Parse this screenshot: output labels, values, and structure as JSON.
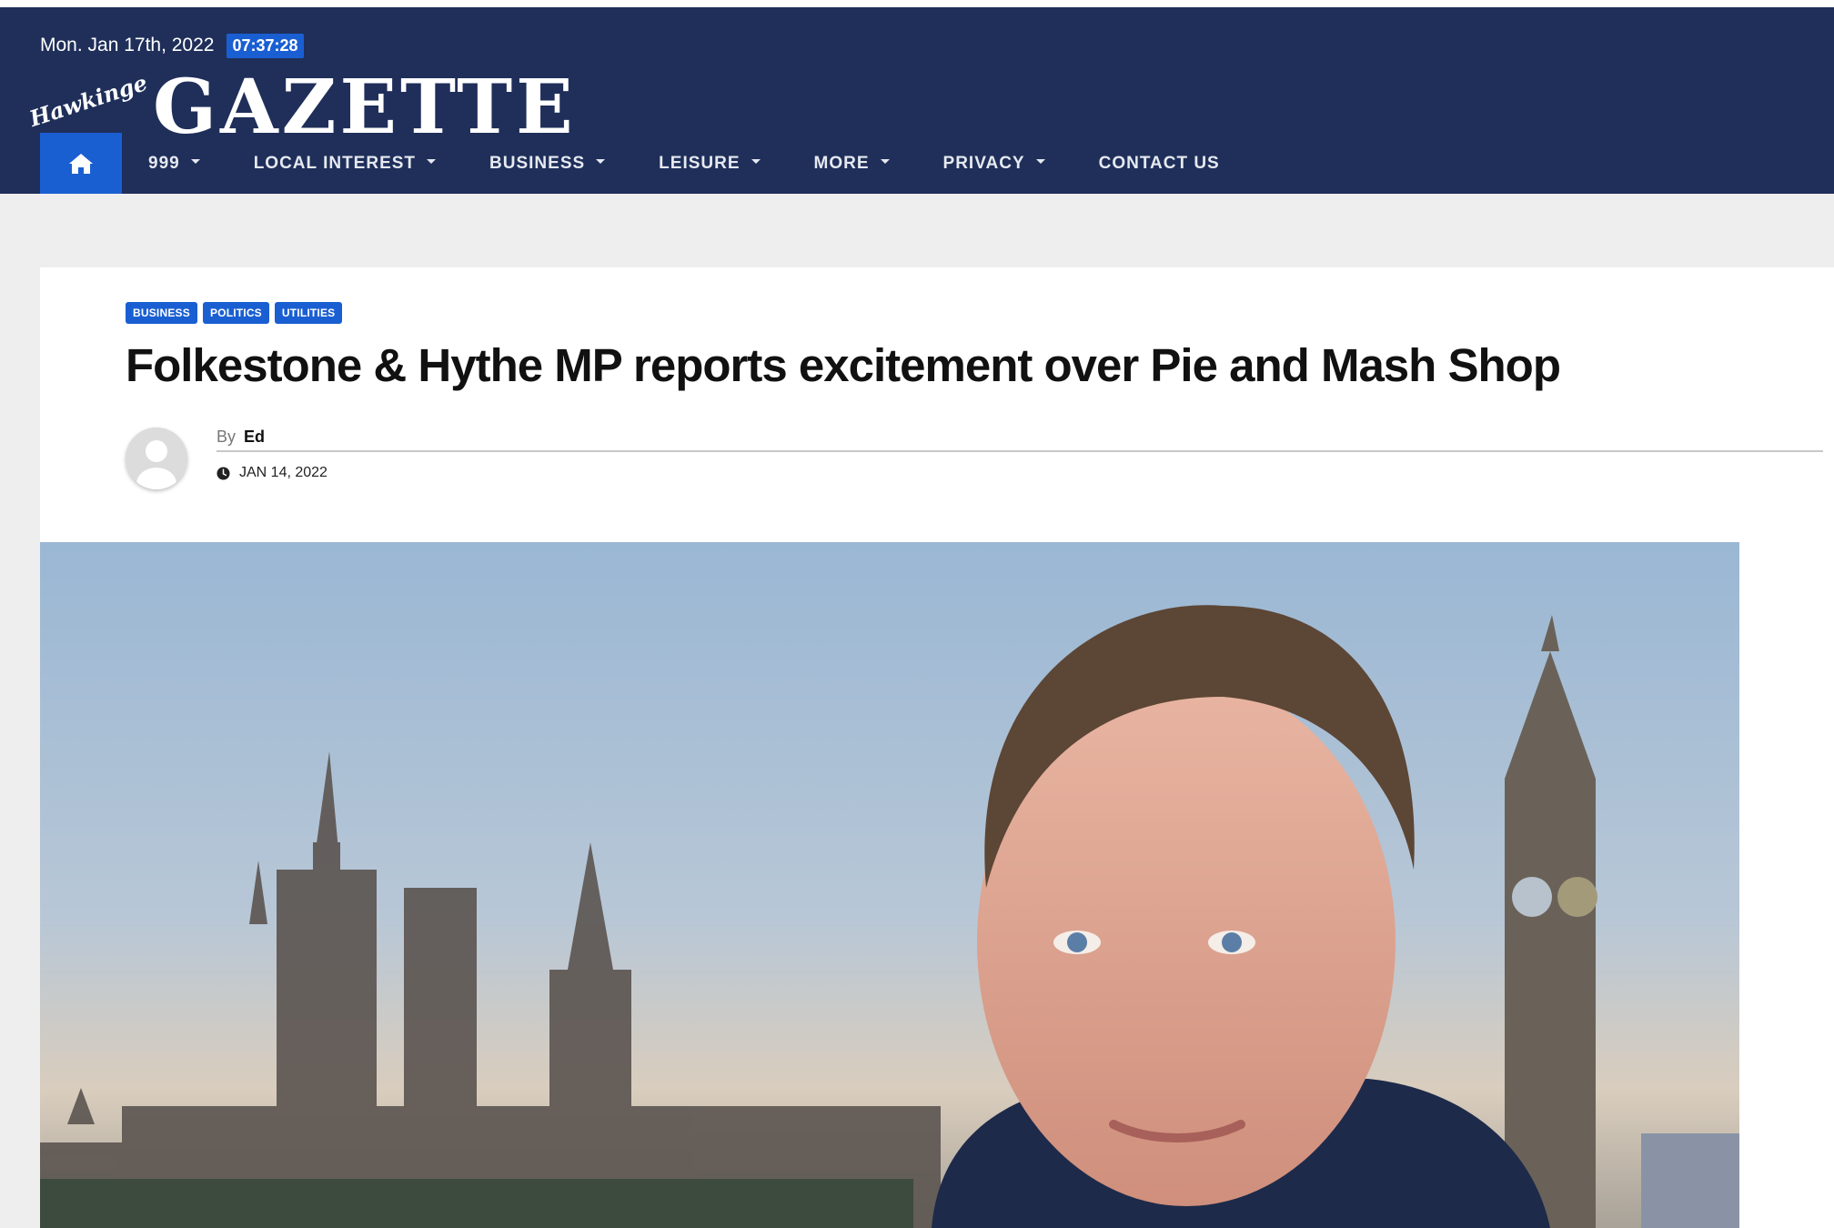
{
  "header": {
    "date": "Mon. Jan 17th, 2022",
    "time": "07:37:28",
    "logo_script": "Hawkinge",
    "logo_main": "GAZETTE",
    "nav": [
      {
        "label": "999",
        "dropdown": true
      },
      {
        "label": "LOCAL INTEREST",
        "dropdown": true
      },
      {
        "label": "BUSINESS",
        "dropdown": true
      },
      {
        "label": "LEISURE",
        "dropdown": true
      },
      {
        "label": "MORE",
        "dropdown": true
      },
      {
        "label": "PRIVACY",
        "dropdown": true
      },
      {
        "label": "CONTACT US",
        "dropdown": false
      }
    ]
  },
  "article": {
    "tags": [
      "BUSINESS",
      "POLITICS",
      "UTILITIES"
    ],
    "title": "Folkestone & Hythe MP reports excitement over Pie and Mash Shop",
    "by_label": "By",
    "author": "Ed",
    "date": "JAN 14, 2022"
  },
  "icons": {
    "home": "home-icon",
    "clock": "clock-icon",
    "avatar": "user-avatar"
  },
  "colors": {
    "header_bg": "#1f2f5a",
    "accent": "#1a5fd2",
    "page_bg": "#eeeeee"
  }
}
